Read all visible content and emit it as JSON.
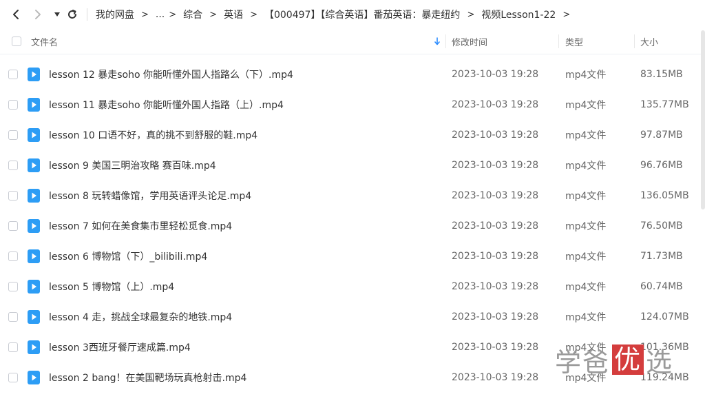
{
  "breadcrumb": {
    "items": [
      "我的网盘",
      "...",
      "综合",
      "英语",
      "【000497】【综合英语】番茄英语：暴走纽约",
      "视频Lesson1-22"
    ],
    "separator": ">"
  },
  "columns": {
    "name": "文件名",
    "modified": "修改时间",
    "type": "类型",
    "size": "大小"
  },
  "files": [
    {
      "name": "lesson 12 暴走soho 你能听懂外国人指路么（下）.mp4",
      "modified": "2023-10-03 19:28",
      "type": "mp4文件",
      "size": "83.15MB"
    },
    {
      "name": "lesson 11 暴走soho 你能听懂外国人指路（上）.mp4",
      "modified": "2023-10-03 19:28",
      "type": "mp4文件",
      "size": "135.77MB"
    },
    {
      "name": "lesson 10 口语不好，真的挑不到舒服的鞋.mp4",
      "modified": "2023-10-03 19:28",
      "type": "mp4文件",
      "size": "97.87MB"
    },
    {
      "name": "lesson 9 美国三明治攻略 赛百味.mp4",
      "modified": "2023-10-03 19:28",
      "type": "mp4文件",
      "size": "96.76MB"
    },
    {
      "name": "lesson 8 玩转蜡像馆，学用英语评头论足.mp4",
      "modified": "2023-10-03 19:28",
      "type": "mp4文件",
      "size": "136.05MB"
    },
    {
      "name": "lesson 7 如何在美食集市里轻松觅食.mp4",
      "modified": "2023-10-03 19:28",
      "type": "mp4文件",
      "size": "76.50MB"
    },
    {
      "name": "lesson 6 博物馆（下）_bilibili.mp4",
      "modified": "2023-10-03 19:28",
      "type": "mp4文件",
      "size": "71.73MB"
    },
    {
      "name": "lesson 5 博物馆（上）.mp4",
      "modified": "2023-10-03 19:28",
      "type": "mp4文件",
      "size": "60.74MB"
    },
    {
      "name": "lesson 4 走，挑战全球最复杂的地铁.mp4",
      "modified": "2023-10-03 19:28",
      "type": "mp4文件",
      "size": "124.07MB"
    },
    {
      "name": "lesson 3西班牙餐厅速成篇.mp4",
      "modified": "2023-10-03 19:28",
      "type": "mp4文件",
      "size": "101.36MB"
    },
    {
      "name": "lesson 2 bang！在美国靶场玩真枪射击.mp4",
      "modified": "2023-10-03 19:28",
      "type": "mp4文件",
      "size": "119.24MB"
    }
  ],
  "watermark": {
    "part1": "学爸",
    "part2": "优",
    "part3": "选"
  },
  "colors": {
    "accent": "#2b8cff",
    "fileIcon": "#2d9df5",
    "watermarkRed": "#d43d3d"
  }
}
